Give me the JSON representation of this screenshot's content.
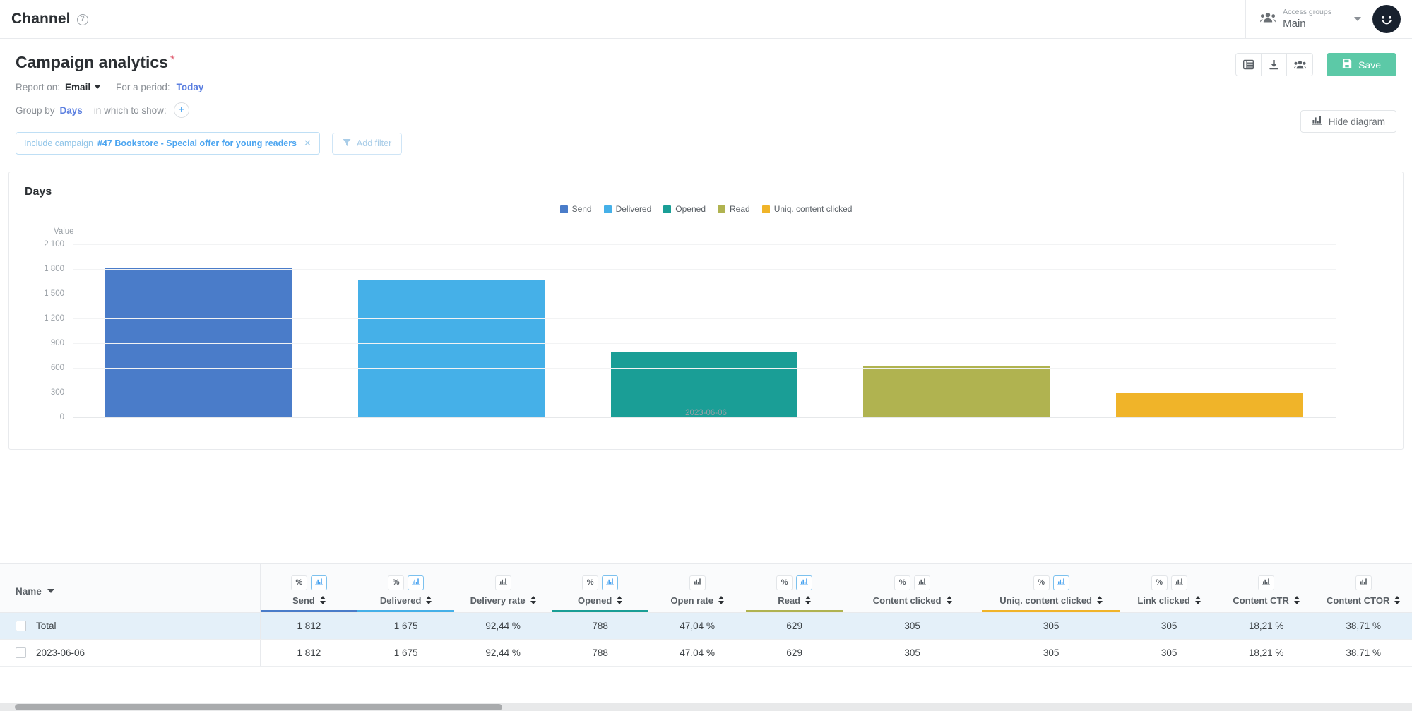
{
  "topbar": {
    "title": "Channel",
    "help_icon": "question-mark-icon",
    "access_groups_label": "Access groups",
    "access_groups_value": "Main",
    "avatar_icon": "smiley-avatar-icon"
  },
  "header": {
    "title": "Campaign analytics",
    "required_marker": "*",
    "report_on_label": "Report on:",
    "report_on_value": "Email",
    "period_label": "For a period:",
    "period_value": "Today",
    "group_by_label": "Group by",
    "group_by_value": "Days",
    "in_which_label": "in which to show:",
    "add_metric_label": "+"
  },
  "toolbar": {
    "table_view_icon": "table-icon",
    "download_icon": "download-icon",
    "share_icon": "people-icon",
    "save_label": "Save",
    "save_icon": "floppy-disk-icon",
    "save_color": "#5cc9a7",
    "hide_diagram_label": "Hide diagram",
    "hide_diagram_icon": "bar-chart-icon"
  },
  "filters": {
    "chip_prefix": "Include campaign",
    "chip_value": "#47 Bookstore - Special offer for young readers",
    "chip_close_icon": "close-icon",
    "add_filter_label": "Add filter",
    "add_filter_icon": "funnel-icon"
  },
  "chart_data": {
    "type": "bar",
    "title": "Days",
    "xlabel": "",
    "ylabel": "Value",
    "categories": [
      "2023-06-06"
    ],
    "tick_labels": [
      "0",
      "300",
      "600",
      "900",
      "1 200",
      "1 500",
      "1 800",
      "2 100"
    ],
    "ticks": [
      0,
      300,
      600,
      900,
      1200,
      1500,
      1800,
      2100
    ],
    "ylim": [
      0,
      2100
    ],
    "grid": true,
    "legend_position": "top-center",
    "series": [
      {
        "name": "Send",
        "values": [
          1812
        ],
        "color": "#4a7cc9"
      },
      {
        "name": "Delivered",
        "values": [
          1675
        ],
        "color": "#45b0e8"
      },
      {
        "name": "Opened",
        "values": [
          788
        ],
        "color": "#1a9e96"
      },
      {
        "name": "Read",
        "values": [
          629
        ],
        "color": "#b0b350"
      },
      {
        "name": "Uniq. content clicked",
        "values": [
          305
        ],
        "color": "#f0b429"
      }
    ]
  },
  "table": {
    "name_column": "Name",
    "percent_icon": "%",
    "chart_icon": "bar-chart-icon",
    "columns": [
      {
        "label": "Send",
        "has_percent": true,
        "has_chart": true,
        "chart_active": true,
        "underline": "#4a7cc9"
      },
      {
        "label": "Delivered",
        "has_percent": true,
        "has_chart": true,
        "chart_active": true,
        "underline": "#45b0e8"
      },
      {
        "label": "Delivery rate",
        "has_percent": false,
        "has_chart": true,
        "chart_active": false,
        "underline": ""
      },
      {
        "label": "Opened",
        "has_percent": true,
        "has_chart": true,
        "chart_active": true,
        "underline": "#1a9e96"
      },
      {
        "label": "Open rate",
        "has_percent": false,
        "has_chart": true,
        "chart_active": false,
        "underline": ""
      },
      {
        "label": "Read",
        "has_percent": true,
        "has_chart": true,
        "chart_active": true,
        "underline": "#b0b350"
      },
      {
        "label": "Content clicked",
        "has_percent": true,
        "has_chart": true,
        "chart_active": false,
        "underline": ""
      },
      {
        "label": "Uniq. content clicked",
        "has_percent": true,
        "has_chart": true,
        "chart_active": true,
        "underline": "#f0b429"
      },
      {
        "label": "Link clicked",
        "has_percent": true,
        "has_chart": true,
        "chart_active": false,
        "underline": ""
      },
      {
        "label": "Content CTR",
        "has_percent": false,
        "has_chart": true,
        "chart_active": false,
        "underline": ""
      },
      {
        "label": "Content CTOR",
        "has_percent": false,
        "has_chart": true,
        "chart_active": false,
        "underline": ""
      }
    ],
    "rows": [
      {
        "name": "Total",
        "is_total": true,
        "values": [
          "1 812",
          "1 675",
          "92,44 %",
          "788",
          "47,04 %",
          "629",
          "305",
          "305",
          "305",
          "18,21 %",
          "38,71 %"
        ]
      },
      {
        "name": "2023-06-06",
        "is_total": false,
        "values": [
          "1 812",
          "1 675",
          "92,44 %",
          "788",
          "47,04 %",
          "629",
          "305",
          "305",
          "305",
          "18,21 %",
          "38,71 %"
        ]
      }
    ]
  }
}
